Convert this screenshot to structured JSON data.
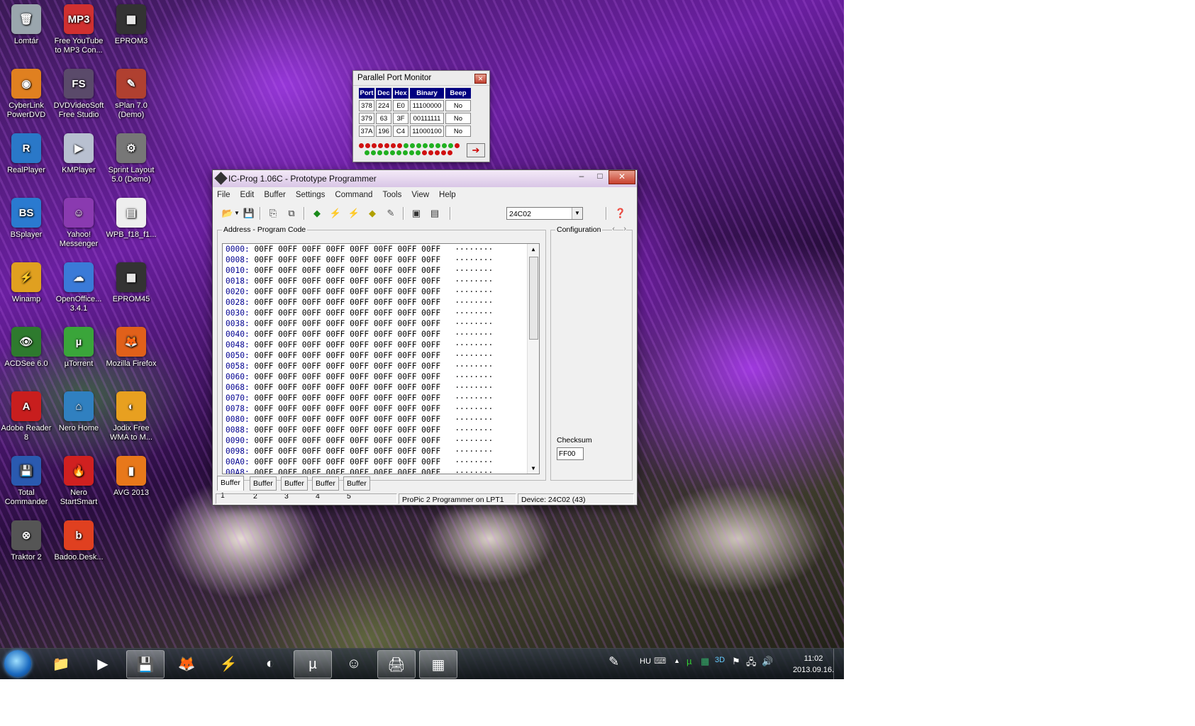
{
  "desktop_icons": [
    {
      "label": "Lomtár",
      "icon": "recycle-bin-icon",
      "color": "#9aa6ad",
      "glyph": "🗑"
    },
    {
      "label": "Free YouTube to MP3 Con...",
      "icon": "mp3-converter-icon",
      "color": "#d03030",
      "glyph": "MP3"
    },
    {
      "label": "EPROM3",
      "icon": "eprom-icon",
      "color": "#333333",
      "glyph": "▦"
    },
    {
      "label": "CyberLink PowerDVD",
      "icon": "powerdvd-icon",
      "color": "#e08020",
      "glyph": "◉"
    },
    {
      "label": "DVDVideoSoft Free Studio",
      "icon": "dvdvideosoft-icon",
      "color": "#5a4a6a",
      "glyph": "FS"
    },
    {
      "label": "sPlan 7.0 (Demo)",
      "icon": "splan-icon",
      "color": "#b04030",
      "glyph": "✎"
    },
    {
      "label": "RealPlayer",
      "icon": "realplayer-icon",
      "color": "#2a78c8",
      "glyph": "R"
    },
    {
      "label": "KMPlayer",
      "icon": "kmplayer-icon",
      "color": "#b8c0d0",
      "glyph": "▶"
    },
    {
      "label": "Sprint Layout 5.0 (Demo)",
      "icon": "sprint-layout-icon",
      "color": "#777777",
      "glyph": "⚙"
    },
    {
      "label": "BSplayer",
      "icon": "bsplayer-icon",
      "color": "#2a7ad0",
      "glyph": "BS"
    },
    {
      "label": "Yahoo! Messenger",
      "icon": "yahoo-messenger-icon",
      "color": "#8a3ab0",
      "glyph": "☺"
    },
    {
      "label": "WPB_f18_f1...",
      "icon": "file-icon",
      "color": "#eeeeee",
      "glyph": "▤"
    },
    {
      "label": "Winamp",
      "icon": "winamp-icon",
      "color": "#e0a020",
      "glyph": "⚡"
    },
    {
      "label": "OpenOffice... 3.4.1",
      "icon": "openoffice-icon",
      "color": "#3a7ad8",
      "glyph": "☁"
    },
    {
      "label": "EPROM45",
      "icon": "eprom-icon",
      "color": "#333333",
      "glyph": "▦"
    },
    {
      "label": "ACDSee 6.0",
      "icon": "acdsee-icon",
      "color": "#2e7a2e",
      "glyph": "👁"
    },
    {
      "label": "µTorrent",
      "icon": "utorrent-icon",
      "color": "#3aa53a",
      "glyph": "µ"
    },
    {
      "label": "Mozilla Firefox",
      "icon": "firefox-icon",
      "color": "#e0601a",
      "glyph": "🦊"
    },
    {
      "label": "Adobe Reader 8",
      "icon": "adobe-reader-icon",
      "color": "#c81e1e",
      "glyph": "A"
    },
    {
      "label": "Nero Home",
      "icon": "nero-home-icon",
      "color": "#3080c0",
      "glyph": "⌂"
    },
    {
      "label": "Jodix Free WMA to M...",
      "icon": "jodix-icon",
      "color": "#e8a020",
      "glyph": "◐"
    },
    {
      "label": "Total Commander",
      "icon": "total-commander-icon",
      "color": "#2a5ab0",
      "glyph": "💾"
    },
    {
      "label": "Nero StartSmart",
      "icon": "nero-startsmart-icon",
      "color": "#d02020",
      "glyph": "🔥"
    },
    {
      "label": "AVG 2013",
      "icon": "avg-icon",
      "color": "#e8781a",
      "glyph": "▮"
    },
    {
      "label": "Traktor 2",
      "icon": "traktor-icon",
      "color": "#555555",
      "glyph": "⊗"
    },
    {
      "label": "Badoo.Desk...",
      "icon": "badoo-icon",
      "color": "#e04020",
      "glyph": "b"
    }
  ],
  "ppm": {
    "title": "Parallel Port Monitor",
    "close_glyph": "✕",
    "headers": [
      "Port",
      "Dec",
      "Hex",
      "Binary",
      "Beep"
    ],
    "rows": [
      [
        "378",
        "224",
        "E0",
        "11100000",
        "No"
      ],
      [
        "379",
        "63",
        "3F",
        "00111111",
        "No"
      ],
      [
        "37A",
        "196",
        "C4",
        "11000100",
        "No"
      ]
    ],
    "arrow_glyph": "➔",
    "led_row1": [
      "#d01010",
      "#d01010",
      "#d01010",
      "#d01010",
      "#d01010",
      "#d01010",
      "#d01010",
      "#20b020",
      "#20b020",
      "#20b020",
      "#20b020",
      "#20b020",
      "#20b020",
      "#20b020",
      "#20b020",
      "#d01010"
    ],
    "led_row2": [
      "#20b020",
      "#20b020",
      "#20b020",
      "#20b020",
      "#20b020",
      "#20b020",
      "#20b020",
      "#20b020",
      "#20b020",
      "#d01010",
      "#d01010",
      "#d01010",
      "#d01010",
      "#d01010"
    ]
  },
  "icprog": {
    "title": "IC-Prog 1.06C - Prototype Programmer",
    "min_glyph": "–",
    "max_glyph": "□",
    "close_glyph": "✕",
    "menu": [
      "File",
      "Edit",
      "Buffer",
      "Settings",
      "Command",
      "Tools",
      "View",
      "Help"
    ],
    "device_select": "24C02",
    "dropdown_glyph": "▼",
    "program_group": "Address - Program Code",
    "config_group": "Configuration",
    "config_nav_left": "‹",
    "config_nav_right": "›",
    "checksum_label": "Checksum",
    "checksum_value": "FF00",
    "rows": [
      "0000:",
      "0008:",
      "0010:",
      "0018:",
      "0020:",
      "0028:",
      "0030:",
      "0038:",
      "0040:",
      "0048:",
      "0050:",
      "0058:",
      "0060:",
      "0068:",
      "0070:",
      "0078:",
      "0080:",
      "0088:",
      "0090:",
      "0098:",
      "00A0:",
      "00A8:"
    ],
    "row_data": "00FF 00FF 00FF 00FF 00FF 00FF 00FF 00FF   ········",
    "scroll_up": "▲",
    "scroll_down": "▼",
    "tabs": [
      "Buffer 1",
      "Buffer 2",
      "Buffer 3",
      "Buffer 4",
      "Buffer 5"
    ],
    "status_programmer": "ProPic 2 Programmer on LPT1",
    "status_device": "Device: 24C02  (43)"
  },
  "taskbar": {
    "lang": "HU",
    "time": "11:02",
    "date": "2013.09.16.",
    "items": [
      {
        "name": "explorer-icon",
        "glyph": "📁"
      },
      {
        "name": "media-player-icon",
        "glyph": "▶"
      },
      {
        "name": "total-commander-icon",
        "glyph": "💾"
      },
      {
        "name": "firefox-icon",
        "glyph": "🦊"
      },
      {
        "name": "winamp-icon",
        "glyph": "⚡"
      },
      {
        "name": "jodix-icon",
        "glyph": "◐"
      },
      {
        "name": "utorrent-icon",
        "glyph": "µ"
      },
      {
        "name": "yahoo-messenger-icon",
        "glyph": "☺"
      },
      {
        "name": "parallel-port-monitor-icon",
        "glyph": "🖨"
      },
      {
        "name": "icprog-icon",
        "glyph": "▦"
      }
    ]
  }
}
